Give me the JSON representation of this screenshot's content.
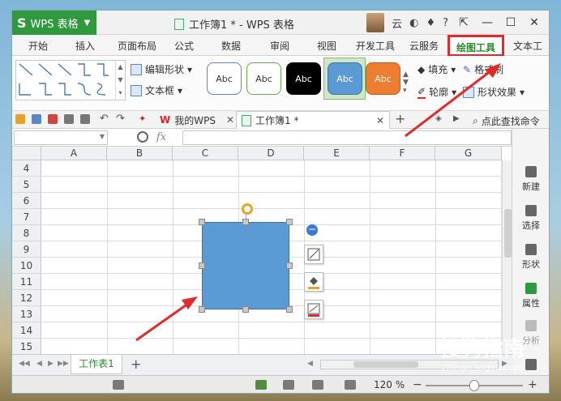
{
  "app": {
    "logo": "S",
    "name": "WPS 表格",
    "window_title": "工作簿1 * - WPS 表格",
    "account_label": "云",
    "help_label": "?"
  },
  "tabs": [
    {
      "label": "开始"
    },
    {
      "label": "插入"
    },
    {
      "label": "页面布局"
    },
    {
      "label": "公式"
    },
    {
      "label": "数据"
    },
    {
      "label": "审阅"
    },
    {
      "label": "视图"
    },
    {
      "label": "开发工具"
    },
    {
      "label": "云服务"
    },
    {
      "label": "绘图工具",
      "active": true
    },
    {
      "label": "文本工"
    }
  ],
  "ribbon": {
    "edit_shape": "编辑形状",
    "text_box": "文本框",
    "style_samples": [
      {
        "label": "Abc",
        "fill": "#ffffff",
        "border": "#5b86c4",
        "text": "#333333"
      },
      {
        "label": "Abc",
        "fill": "#ffffff",
        "border": "#6aa84f",
        "text": "#333333"
      },
      {
        "label": "Abc",
        "fill": "#000000",
        "border": "#000000",
        "text": "#ffffff"
      },
      {
        "label": "Abc",
        "fill": "#5b9bd5",
        "border": "#41719c",
        "text": "#ffffff"
      },
      {
        "label": "Abc",
        "fill": "#ed7d31",
        "border": "#c55a11",
        "text": "#ffffff"
      }
    ],
    "fill": "填充",
    "outline": "轮廓",
    "format_painter": "格式刷",
    "shape_effects": "形状效果"
  },
  "quickbar": {
    "my_wps": "我的WPS",
    "doc_tab": "工作簿1 *",
    "find_command": "点此查找命令"
  },
  "formula_bar": {
    "name_box": "",
    "fx": "fx",
    "formula": ""
  },
  "columns": [
    "A",
    "B",
    "C",
    "D",
    "E",
    "F",
    "G"
  ],
  "rows": [
    "4",
    "5",
    "6",
    "7",
    "8",
    "9",
    "10",
    "11",
    "12",
    "13",
    "14",
    "15"
  ],
  "side_panel": [
    {
      "label": "新建"
    },
    {
      "label": "选择"
    },
    {
      "label": "形状"
    },
    {
      "label": "属性"
    },
    {
      "label": "分析"
    }
  ],
  "sheet_tabs": {
    "active": "工作表1",
    "add": "+"
  },
  "status": {
    "zoom": "120 %",
    "zoom_level": 0.5
  },
  "watermark": {
    "text": "搜狗指南",
    "url": "zhinan.sogou.com"
  },
  "colors": {
    "accent_green": "#2f9a3d",
    "annotation_red": "#e02b2b",
    "shape_fill": "#5b9bd5"
  }
}
